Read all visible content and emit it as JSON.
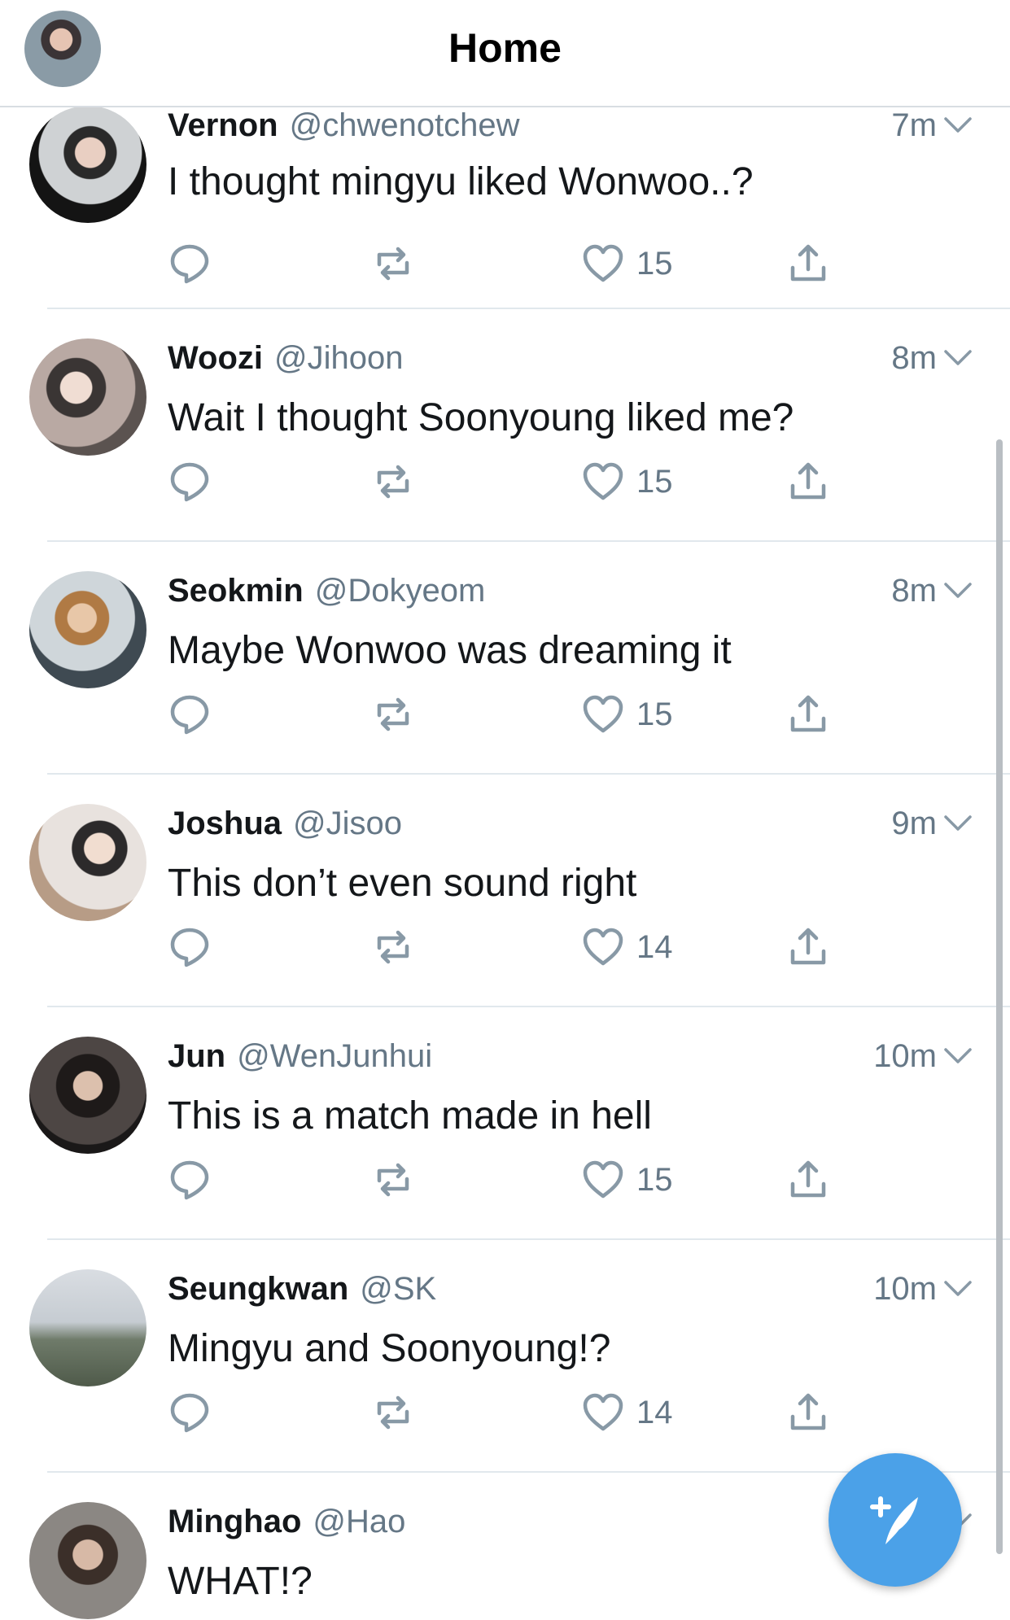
{
  "header": {
    "title": "Home"
  },
  "tweets": [
    {
      "name": "Vernon",
      "handle": "@chwenotchew",
      "time": "7m",
      "text": "I thought mingyu liked Wonwoo..?",
      "likes": "15"
    },
    {
      "name": "Woozi",
      "handle": "@Jihoon",
      "time": "8m",
      "text": "Wait I thought Soonyoung liked me?",
      "likes": "15"
    },
    {
      "name": "Seokmin",
      "handle": "@Dokyeom",
      "time": "8m",
      "text": "Maybe Wonwoo was dreaming it",
      "likes": "15"
    },
    {
      "name": "Joshua",
      "handle": "@Jisoo",
      "time": "9m",
      "text": "This don’t even sound right",
      "likes": "14"
    },
    {
      "name": "Jun",
      "handle": "@WenJunhui",
      "time": "10m",
      "text": "This is a match made in hell",
      "likes": "15"
    },
    {
      "name": "Seungkwan",
      "handle": "@SK",
      "time": "10m",
      "text": "Mingyu and Soonyoung!?",
      "likes": "14"
    },
    {
      "name": "Minghao",
      "handle": "@Hao",
      "time": "",
      "text": "WHAT!?",
      "likes": ""
    }
  ],
  "icons": {
    "reply": "reply-icon",
    "retweet": "retweet-icon",
    "like": "heart-icon",
    "share": "share-icon",
    "compose": "compose-tweet-icon",
    "caret": "chevron-down-icon"
  },
  "colors": {
    "accent": "#4ba1e8",
    "secondary_text": "#657786",
    "divider": "#e1e8ed"
  }
}
